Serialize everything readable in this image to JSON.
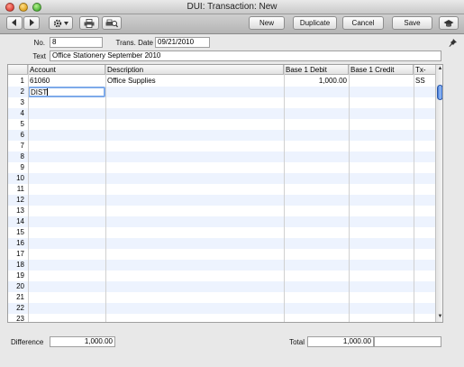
{
  "window": {
    "title": "DUI: Transaction: New"
  },
  "toolbar": {
    "new_label": "New",
    "duplicate_label": "Duplicate",
    "cancel_label": "Cancel",
    "save_label": "Save"
  },
  "header": {
    "no_label": "No.",
    "no_value": "8",
    "trans_date_label": "Trans. Date",
    "trans_date_value": "09/21/2010",
    "text_label": "Text",
    "text_value": "Office Stationery September 2010"
  },
  "grid": {
    "columns": [
      "Account",
      "Description",
      "Base 1 Debit",
      "Base 1 Credit",
      "Tx-"
    ],
    "rows": [
      {
        "num": "1",
        "account": "61060",
        "description": "Office Supplies",
        "debit": "1,000.00",
        "credit": "",
        "tx": "SS"
      },
      {
        "num": "2",
        "account": "DIST",
        "description": "",
        "debit": "",
        "credit": "",
        "tx": ""
      },
      {
        "num": "3"
      },
      {
        "num": "4"
      },
      {
        "num": "5"
      },
      {
        "num": "6"
      },
      {
        "num": "7"
      },
      {
        "num": "8"
      },
      {
        "num": "9"
      },
      {
        "num": "10"
      },
      {
        "num": "11"
      },
      {
        "num": "12"
      },
      {
        "num": "13"
      },
      {
        "num": "14"
      },
      {
        "num": "15"
      },
      {
        "num": "16"
      },
      {
        "num": "17"
      },
      {
        "num": "18"
      },
      {
        "num": "19"
      },
      {
        "num": "20"
      },
      {
        "num": "21"
      },
      {
        "num": "22"
      },
      {
        "num": "23"
      }
    ]
  },
  "footer": {
    "difference_label": "Difference",
    "difference_value": "1,000.00",
    "total_label": "Total",
    "total_value": "1,000.00",
    "total_credit_value": ""
  },
  "icons": {
    "nav_back": "triangle-left-icon",
    "nav_forward": "triangle-right-icon",
    "operations": "gear-icon",
    "print": "printer-icon",
    "print_preview": "print-preview-icon",
    "personal_desktop": "graduation-cap-icon",
    "pin": "pushpin-icon"
  }
}
